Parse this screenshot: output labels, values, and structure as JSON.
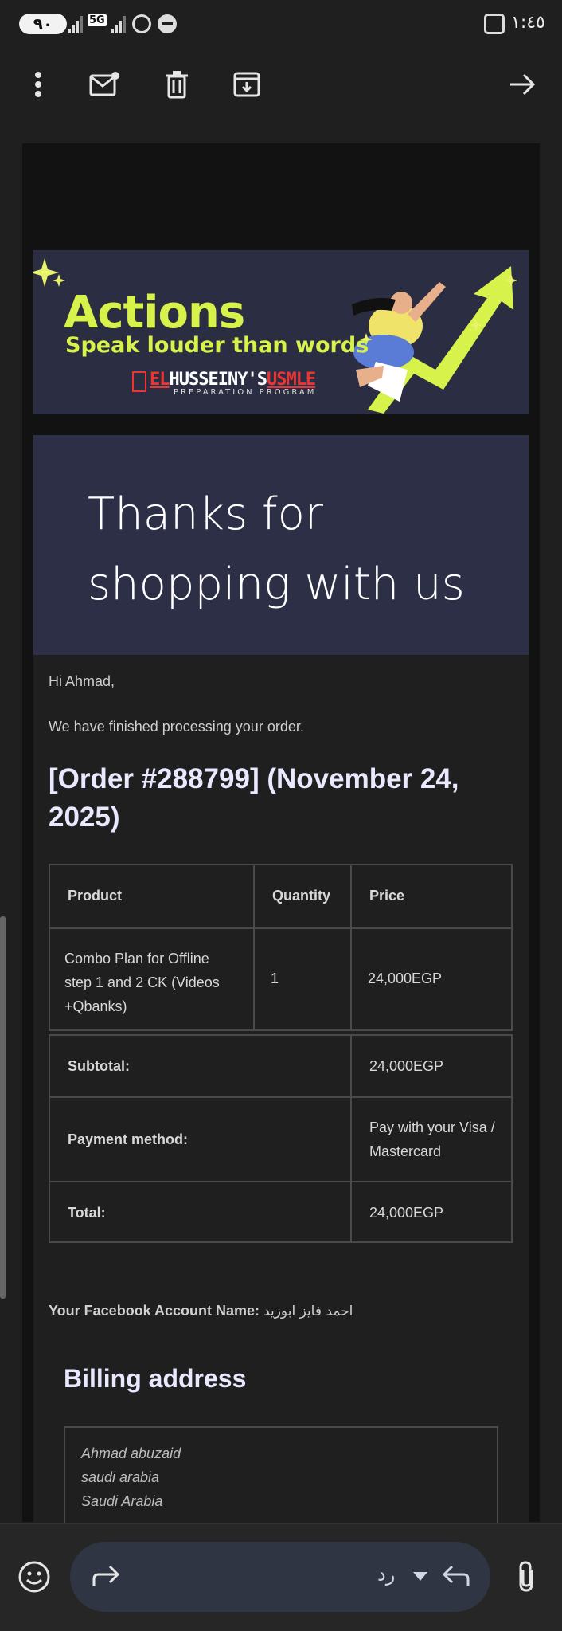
{
  "status_bar": {
    "battery": "٩٠",
    "network": "5G",
    "time": "١:٤٥"
  },
  "toolbar": {
    "icons": [
      "more-vert-icon",
      "mark-unread-icon",
      "delete-icon",
      "archive-icon",
      "forward-arrow-icon"
    ]
  },
  "banner": {
    "title": "Actions",
    "subtitle": "Speak louder than words",
    "brand_left": "EL",
    "brand_main": "HUSSEINY'S",
    "brand_right": "USMLE",
    "program": "PREPARATION PROGRAM"
  },
  "hero": {
    "heading": "Thanks for shopping with us"
  },
  "email": {
    "greeting": "Hi Ahmad,",
    "intro": "We have finished processing your order.",
    "order_heading": "[Order #288799] (November 24, 2025)",
    "table": {
      "headers": {
        "product": "Product",
        "quantity": "Quantity",
        "price": "Price"
      },
      "items": [
        {
          "product": "Combo Plan for Offline step 1 and 2 CK (Videos +Qbanks)",
          "quantity": "1",
          "price": "24,000EGP"
        }
      ],
      "totals": [
        {
          "label": "Subtotal:",
          "value": "24,000EGP"
        },
        {
          "label": "Payment method:",
          "value": "Pay with your Visa / Mastercard"
        },
        {
          "label": "Total:",
          "value": "24,000EGP"
        }
      ]
    },
    "facebook_label": "Your Facebook Account Name:",
    "facebook_value": "احمد فايز ابوزيد",
    "billing_title": "Billing address",
    "billing_lines": [
      "Ahmad abuzaid",
      "saudi arabia",
      "Saudi Arabia"
    ]
  },
  "bottom_bar": {
    "reply_label": "رد",
    "icons": [
      "emoji-icon",
      "forward-icon",
      "dropdown-icon",
      "reply-icon",
      "attachment-icon"
    ]
  }
}
